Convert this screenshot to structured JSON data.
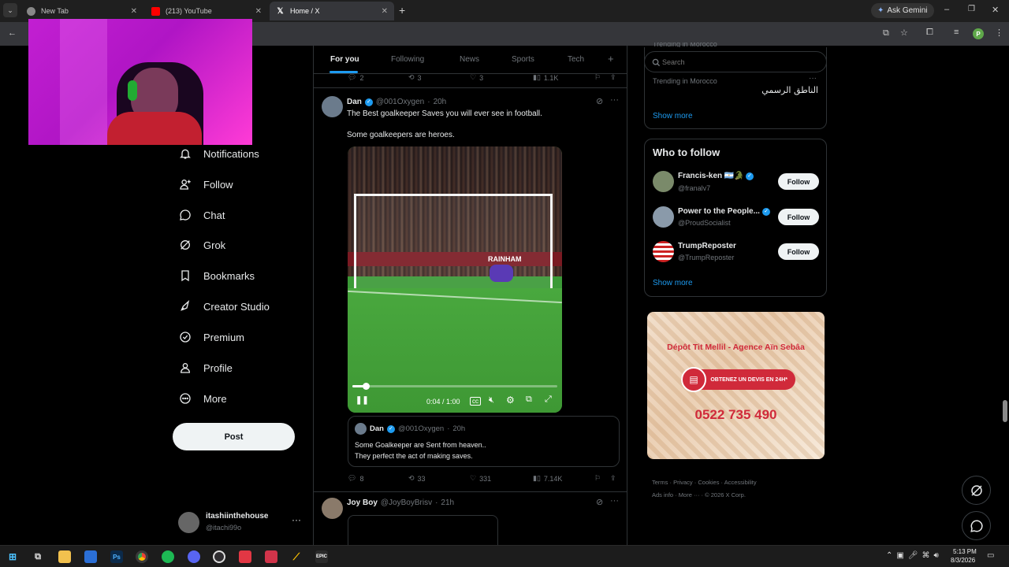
{
  "browser": {
    "tabs": [
      {
        "label": "New Tab"
      },
      {
        "label": "(213) YouTube"
      },
      {
        "label": "Home / X"
      }
    ],
    "ask_gemini": "Ask Gemini",
    "profile_letter": "P"
  },
  "nav": {
    "items": [
      {
        "label": "Notifications",
        "icon": "bell-icon"
      },
      {
        "label": "Follow",
        "icon": "person-add-icon"
      },
      {
        "label": "Chat",
        "icon": "chat-icon"
      },
      {
        "label": "Grok",
        "icon": "grok-icon"
      },
      {
        "label": "Bookmarks",
        "icon": "bookmark-icon"
      },
      {
        "label": "Creator Studio",
        "icon": "rocket-icon"
      },
      {
        "label": "Premium",
        "icon": "verified-icon"
      },
      {
        "label": "Profile",
        "icon": "person-icon"
      },
      {
        "label": "More",
        "icon": "more-circle-icon"
      }
    ],
    "post_label": "Post",
    "account": {
      "name": "itashiinthehouse",
      "handle": "@itachi99o"
    }
  },
  "feed": {
    "tabs": [
      "For you",
      "Following",
      "News",
      "Sports",
      "Tech"
    ],
    "prev_stats": {
      "replies": "2",
      "reposts": "3",
      "likes": "3",
      "views": "1.1K"
    },
    "tweet1": {
      "name": "Dan",
      "handle": "@001Oxygen",
      "time": "20h",
      "line1": "The Best goalkeeper Saves you will ever see in football.",
      "line2": "Some goalkeepers are heroes.",
      "video": {
        "time": "0:04 / 1:00",
        "progress": 0.067,
        "banner": "RAINHAM"
      },
      "quote": {
        "name": "Dan",
        "handle": "@001Oxygen",
        "time": "20h",
        "line1": "Some Goalkeeper are Sent from heaven..",
        "line2": "They perfect the act of making saves."
      },
      "stats": {
        "replies": "8",
        "reposts": "33",
        "likes": "331",
        "views": "7.14K"
      }
    },
    "tweet2": {
      "name": "Joy Boy",
      "handle": "@JoyBoyBrisv",
      "time": "21h"
    }
  },
  "sidebar": {
    "search_placeholder": "Search",
    "trending_partial": "Trending in Morocco",
    "trend_label": "Trending in Morocco",
    "trend_text": "الناطق الرسمي",
    "show_more": "Show more",
    "who_to_follow": "Who to follow",
    "follow_label": "Follow",
    "suggestions": [
      {
        "name": "Francis-ken 🇦🇷🐊",
        "handle": "@franalv7",
        "verified": true
      },
      {
        "name": "Power to the People...",
        "handle": "@ProudSocialist",
        "verified": true
      },
      {
        "name": "TrumpReposter",
        "handle": "@TrumpReposter",
        "verified": false
      }
    ],
    "show_more2": "Show more",
    "ad": {
      "title": "Dépôt Tit Mellil - Agence Aïn Sebâa",
      "badge": "OBTENEZ UN DEVIS EN 24H*",
      "phone": "0522 735 490"
    },
    "footer": [
      "Terms",
      "Privacy",
      "Cookies",
      "Accessibility",
      "Ads info",
      "More ···",
      "© 2026 X Corp."
    ]
  },
  "taskbar": {
    "time": "5:13 PM",
    "date": "8/3/2026"
  },
  "colors": {
    "accent": "#1d9bf0",
    "bg": "#000000",
    "border": "#2f3336",
    "muted": "#71767b"
  }
}
